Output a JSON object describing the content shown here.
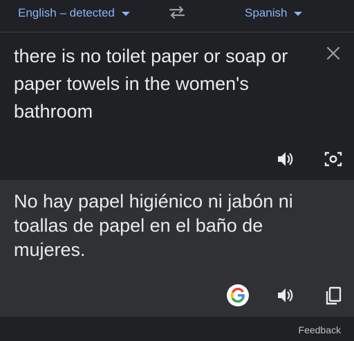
{
  "languages": {
    "source_label": "English – detected",
    "target_label": "Spanish"
  },
  "source": {
    "text": "there is no toilet paper or soap or paper towels in the women's bathroom"
  },
  "translation": {
    "text": "No hay papel higiénico ni jabón ni toallas de papel en el baño de mujeres."
  },
  "footer": {
    "feedback_label": "Feedback"
  },
  "colors": {
    "accent": "#8ab4f8",
    "background": "#202124",
    "result_panel": "#303134",
    "text": "#e8eaed",
    "icon": "#e8eaed"
  },
  "icons": [
    "chevron-down-icon",
    "swap-icon",
    "close-icon",
    "speaker-icon",
    "camera-icon",
    "google-logo-icon",
    "copy-icon"
  ]
}
